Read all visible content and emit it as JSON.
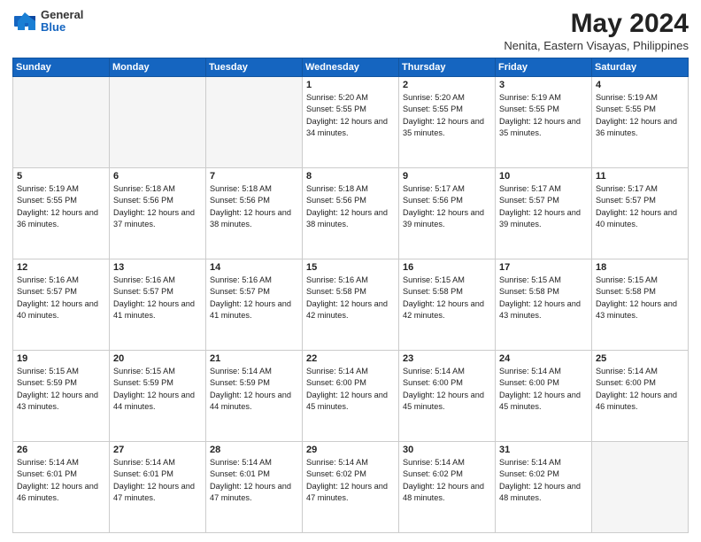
{
  "logo": {
    "general": "General",
    "blue": "Blue"
  },
  "title": "May 2024",
  "subtitle": "Nenita, Eastern Visayas, Philippines",
  "weekdays": [
    "Sunday",
    "Monday",
    "Tuesday",
    "Wednesday",
    "Thursday",
    "Friday",
    "Saturday"
  ],
  "weeks": [
    [
      {
        "day": "",
        "empty": true
      },
      {
        "day": "",
        "empty": true
      },
      {
        "day": "",
        "empty": true
      },
      {
        "day": "1",
        "sunrise": "5:20 AM",
        "sunset": "5:55 PM",
        "daylight": "12 hours and 34 minutes."
      },
      {
        "day": "2",
        "sunrise": "5:20 AM",
        "sunset": "5:55 PM",
        "daylight": "12 hours and 35 minutes."
      },
      {
        "day": "3",
        "sunrise": "5:19 AM",
        "sunset": "5:55 PM",
        "daylight": "12 hours and 35 minutes."
      },
      {
        "day": "4",
        "sunrise": "5:19 AM",
        "sunset": "5:55 PM",
        "daylight": "12 hours and 36 minutes."
      }
    ],
    [
      {
        "day": "5",
        "sunrise": "5:19 AM",
        "sunset": "5:55 PM",
        "daylight": "12 hours and 36 minutes."
      },
      {
        "day": "6",
        "sunrise": "5:18 AM",
        "sunset": "5:56 PM",
        "daylight": "12 hours and 37 minutes."
      },
      {
        "day": "7",
        "sunrise": "5:18 AM",
        "sunset": "5:56 PM",
        "daylight": "12 hours and 38 minutes."
      },
      {
        "day": "8",
        "sunrise": "5:18 AM",
        "sunset": "5:56 PM",
        "daylight": "12 hours and 38 minutes."
      },
      {
        "day": "9",
        "sunrise": "5:17 AM",
        "sunset": "5:56 PM",
        "daylight": "12 hours and 39 minutes."
      },
      {
        "day": "10",
        "sunrise": "5:17 AM",
        "sunset": "5:57 PM",
        "daylight": "12 hours and 39 minutes."
      },
      {
        "day": "11",
        "sunrise": "5:17 AM",
        "sunset": "5:57 PM",
        "daylight": "12 hours and 40 minutes."
      }
    ],
    [
      {
        "day": "12",
        "sunrise": "5:16 AM",
        "sunset": "5:57 PM",
        "daylight": "12 hours and 40 minutes."
      },
      {
        "day": "13",
        "sunrise": "5:16 AM",
        "sunset": "5:57 PM",
        "daylight": "12 hours and 41 minutes."
      },
      {
        "day": "14",
        "sunrise": "5:16 AM",
        "sunset": "5:57 PM",
        "daylight": "12 hours and 41 minutes."
      },
      {
        "day": "15",
        "sunrise": "5:16 AM",
        "sunset": "5:58 PM",
        "daylight": "12 hours and 42 minutes."
      },
      {
        "day": "16",
        "sunrise": "5:15 AM",
        "sunset": "5:58 PM",
        "daylight": "12 hours and 42 minutes."
      },
      {
        "day": "17",
        "sunrise": "5:15 AM",
        "sunset": "5:58 PM",
        "daylight": "12 hours and 43 minutes."
      },
      {
        "day": "18",
        "sunrise": "5:15 AM",
        "sunset": "5:58 PM",
        "daylight": "12 hours and 43 minutes."
      }
    ],
    [
      {
        "day": "19",
        "sunrise": "5:15 AM",
        "sunset": "5:59 PM",
        "daylight": "12 hours and 43 minutes."
      },
      {
        "day": "20",
        "sunrise": "5:15 AM",
        "sunset": "5:59 PM",
        "daylight": "12 hours and 44 minutes."
      },
      {
        "day": "21",
        "sunrise": "5:14 AM",
        "sunset": "5:59 PM",
        "daylight": "12 hours and 44 minutes."
      },
      {
        "day": "22",
        "sunrise": "5:14 AM",
        "sunset": "6:00 PM",
        "daylight": "12 hours and 45 minutes."
      },
      {
        "day": "23",
        "sunrise": "5:14 AM",
        "sunset": "6:00 PM",
        "daylight": "12 hours and 45 minutes."
      },
      {
        "day": "24",
        "sunrise": "5:14 AM",
        "sunset": "6:00 PM",
        "daylight": "12 hours and 45 minutes."
      },
      {
        "day": "25",
        "sunrise": "5:14 AM",
        "sunset": "6:00 PM",
        "daylight": "12 hours and 46 minutes."
      }
    ],
    [
      {
        "day": "26",
        "sunrise": "5:14 AM",
        "sunset": "6:01 PM",
        "daylight": "12 hours and 46 minutes."
      },
      {
        "day": "27",
        "sunrise": "5:14 AM",
        "sunset": "6:01 PM",
        "daylight": "12 hours and 47 minutes."
      },
      {
        "day": "28",
        "sunrise": "5:14 AM",
        "sunset": "6:01 PM",
        "daylight": "12 hours and 47 minutes."
      },
      {
        "day": "29",
        "sunrise": "5:14 AM",
        "sunset": "6:02 PM",
        "daylight": "12 hours and 47 minutes."
      },
      {
        "day": "30",
        "sunrise": "5:14 AM",
        "sunset": "6:02 PM",
        "daylight": "12 hours and 48 minutes."
      },
      {
        "day": "31",
        "sunrise": "5:14 AM",
        "sunset": "6:02 PM",
        "daylight": "12 hours and 48 minutes."
      },
      {
        "day": "",
        "empty": true
      }
    ]
  ]
}
